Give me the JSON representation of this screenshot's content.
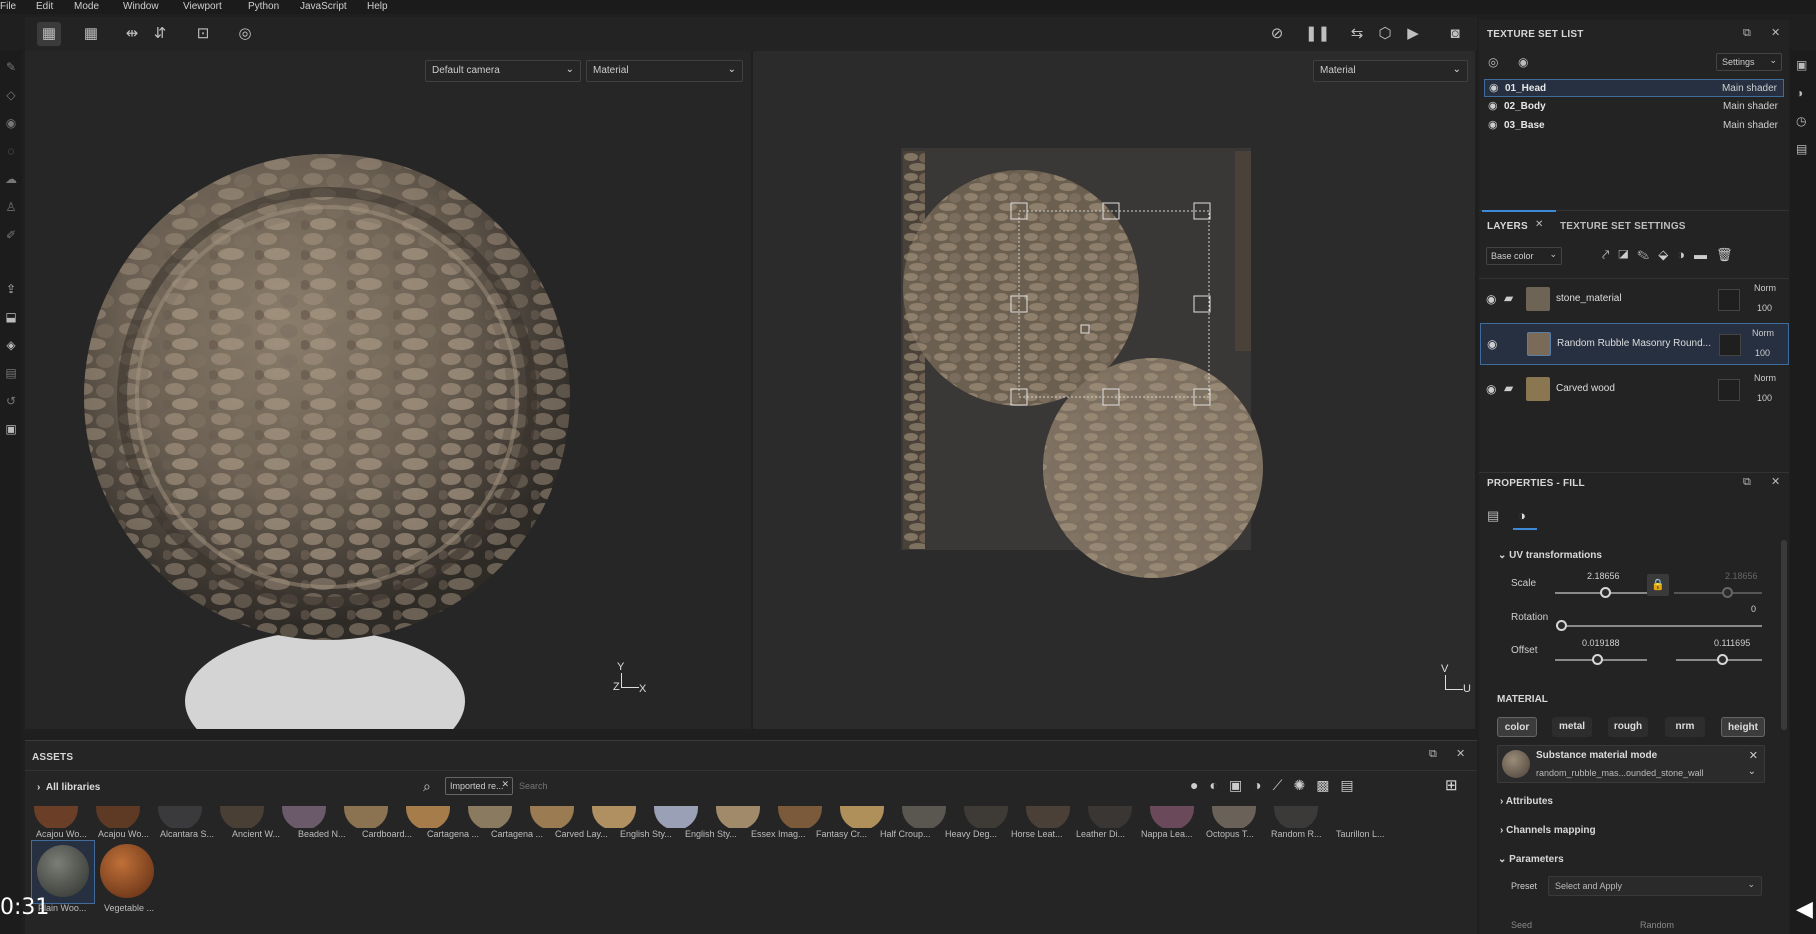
{
  "menu": [
    "File",
    "Edit",
    "Mode",
    "Window",
    "Viewport",
    "Python",
    "JavaScript",
    "Help"
  ],
  "viewport3d": {
    "camera_select": "Default camera",
    "channel_select": "Material",
    "axis_y": "Y",
    "axis_z": "Z",
    "axis_x": "X"
  },
  "viewport2d": {
    "channel_select": "Material",
    "axis_v": "V",
    "axis_u": "U"
  },
  "texture_set_list": {
    "title": "TEXTURE SET LIST",
    "settings_label": "Settings",
    "items": [
      {
        "name": "01_Head",
        "shader": "Main shader",
        "selected": true
      },
      {
        "name": "02_Body",
        "shader": "Main shader",
        "selected": false
      },
      {
        "name": "03_Base",
        "shader": "Main shader",
        "selected": false
      }
    ]
  },
  "layers_panel": {
    "tab_layers": "LAYERS",
    "tab_texture_set_settings": "TEXTURE SET SETTINGS",
    "channel_select": "Base color",
    "layers": [
      {
        "name": "stone_material",
        "blend": "Norm",
        "opacity": "100",
        "thumb_color": "#6d6456"
      },
      {
        "name": "Random Rubble Masonry Round...",
        "blend": "Norm",
        "opacity": "100",
        "thumb_color": "#7a6a58"
      },
      {
        "name": "Carved wood",
        "blend": "Norm",
        "opacity": "100",
        "thumb_color": "#8a7650"
      }
    ]
  },
  "properties": {
    "title": "PROPERTIES - FILL",
    "uv_section": "UV transformations",
    "scale_label": "Scale",
    "scale_value": "2.18656",
    "scale_value_locked": "2.18656",
    "rotation_label": "Rotation",
    "rotation_value": "0",
    "offset_label": "Offset",
    "offset_u": "0.019188",
    "offset_v": "0.111695",
    "material_section": "MATERIAL",
    "channels": [
      "color",
      "metal",
      "rough",
      "nrm",
      "height"
    ],
    "substance_mode_title": "Substance material mode",
    "substance_file": "random_rubble_mas...ounded_stone_wall",
    "attributes": "Attributes",
    "channels_mapping": "Channels mapping",
    "parameters": "Parameters",
    "preset_label": "Preset",
    "preset_value": "Select and Apply",
    "seed_label": "Seed",
    "seed_value": "Random"
  },
  "assets": {
    "title": "ASSETS",
    "library": "All libraries",
    "filter_chip": "Imported re...",
    "search_placeholder": "Search",
    "items": [
      {
        "label": "Acajou Wo...",
        "color": "#6b3f27"
      },
      {
        "label": "Acajou Wo...",
        "color": "#5e3a25"
      },
      {
        "label": "Alcantara S...",
        "color": "#3a3a3c"
      },
      {
        "label": "Ancient W...",
        "color": "#4a3f35"
      },
      {
        "label": "Beaded N...",
        "color": "#6a5a6a"
      },
      {
        "label": "Cardboard...",
        "color": "#8b7250"
      },
      {
        "label": "Cartagena ...",
        "color": "#a67d4a"
      },
      {
        "label": "Cartagena ...",
        "color": "#8a7a60"
      },
      {
        "label": "Carved Lay...",
        "color": "#9a7b52"
      },
      {
        "label": "English Sty...",
        "color": "#b09060"
      },
      {
        "label": "English Sty...",
        "color": "#9aa0b5"
      },
      {
        "label": "Essex Imag...",
        "color": "#a08a6a"
      },
      {
        "label": "Fantasy Cr...",
        "color": "#7a5a3a"
      },
      {
        "label": "Half Croup...",
        "color": "#b0905a"
      },
      {
        "label": "Heavy Deg...",
        "color": "#5a5650"
      },
      {
        "label": "Horse Leat...",
        "color": "#3e3a36"
      },
      {
        "label": "Leather Di...",
        "color": "#4a4038"
      },
      {
        "label": "Nappa Lea...",
        "color": "#3a3634"
      },
      {
        "label": "Octopus T...",
        "color": "#6a4a5a"
      },
      {
        "label": "Random R...",
        "color": "#6a6258"
      },
      {
        "label": "Taurillon L...",
        "color": "#3c3a38"
      }
    ],
    "row2": [
      {
        "label": "Plain Woo...",
        "color": "#4a4e48"
      },
      {
        "label": "Vegetable ...",
        "color": "#a0582a"
      }
    ]
  },
  "video_time": "0:31"
}
